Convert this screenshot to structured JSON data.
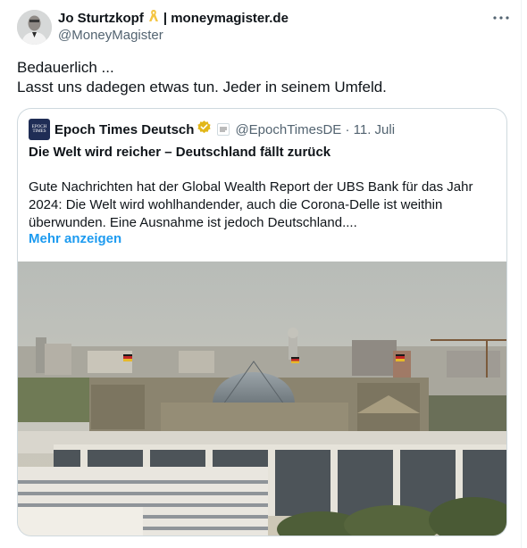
{
  "post": {
    "author_name": "Jo Sturtzkopf",
    "author_brand": "| moneymagister.de",
    "author_handle": "@MoneyMagister",
    "more_icon": "more-horizontal-icon",
    "text_lines": [
      "Bedauerlich ...",
      "Lasst uns dadegen etwas tun. Jeder in seinem Umfeld."
    ]
  },
  "quote": {
    "logo_lines": [
      "EPOCH",
      "TIMES"
    ],
    "name": "Epoch Times Deutsch",
    "affiliate_badge": "THE EPOCH TIMES",
    "handle_date": "@EpochTimesDE · 11. Juli",
    "title": "Die Welt wird reicher – Deutschland fällt zurück",
    "body_lines": [
      "Gute Nachrichten hat der Global Wealth Report der UBS Bank für das Jahr",
      "2024: Die Welt wird wohlhandender, auch die Corona-Delle ist weithin",
      "überwunden. Eine Ausnahme ist jedoch Deutschland...."
    ],
    "show_more": "Mehr anzeigen",
    "image_alt": "Berlin skyline with the Reichstag dome"
  },
  "colors": {
    "text": "#0f1419",
    "secondary": "#536471",
    "link": "#1d9bf0",
    "border": "#cfd9de",
    "verified_gold": "#e2b719",
    "ribbon_gold": "#f4c542"
  }
}
